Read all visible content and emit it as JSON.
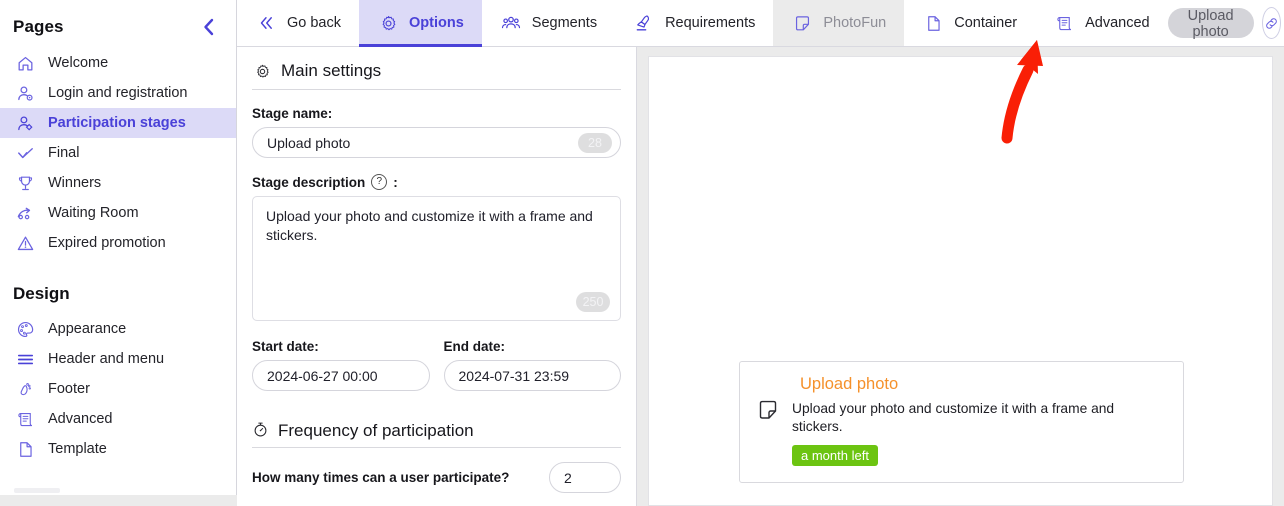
{
  "sidebar": {
    "pages_title": "Pages",
    "collapse_icon": "chevron-left-icon",
    "pages": [
      {
        "label": "Welcome",
        "icon": "home-icon",
        "active": false
      },
      {
        "label": "Login and registration",
        "icon": "user-gear-icon",
        "active": false
      },
      {
        "label": "Participation stages",
        "icon": "user-stages-icon",
        "active": true
      },
      {
        "label": "Final",
        "icon": "check-badge-icon",
        "active": false
      },
      {
        "label": "Winners",
        "icon": "trophy-icon",
        "active": false
      },
      {
        "label": "Waiting Room",
        "icon": "waiting-room-icon",
        "active": false
      },
      {
        "label": "Expired promotion",
        "icon": "warning-triangle-icon",
        "active": false
      }
    ],
    "design_title": "Design",
    "design": [
      {
        "label": "Appearance",
        "icon": "palette-icon"
      },
      {
        "label": "Header and menu",
        "icon": "menu-lines-icon"
      },
      {
        "label": "Footer",
        "icon": "footprint-icon"
      },
      {
        "label": "Advanced",
        "icon": "scroll-icon"
      },
      {
        "label": "Template",
        "icon": "page-icon"
      }
    ]
  },
  "tabs": [
    {
      "label": "Go back",
      "icon": "double-chevron-left-icon",
      "state": "normal"
    },
    {
      "label": "Options",
      "icon": "gear-icon",
      "state": "active"
    },
    {
      "label": "Segments",
      "icon": "people-group-icon",
      "state": "normal"
    },
    {
      "label": "Requirements",
      "icon": "stamp-icon",
      "state": "normal"
    },
    {
      "label": "PhotoFun",
      "icon": "sticker-icon",
      "state": "muted"
    },
    {
      "label": "Container",
      "icon": "page-icon",
      "state": "normal"
    },
    {
      "label": "Advanced",
      "icon": "scroll-icon",
      "state": "normal"
    }
  ],
  "toolbar": {
    "upload_button": "Upload photo",
    "link_icon": "link-chain-icon"
  },
  "settings": {
    "main_section": {
      "icon": "gear-icon",
      "title": "Main settings"
    },
    "stage_name": {
      "label": "Stage name:",
      "value": "Upload photo",
      "counter": "28"
    },
    "stage_description": {
      "label": "Stage description",
      "help_icon": "question-mark-icon",
      "colon": ":",
      "value": "Upload your photo and customize it with a frame and stickers.",
      "counter": "250"
    },
    "start_date": {
      "label": "Start date:",
      "value": "2024-06-27 00:00"
    },
    "end_date": {
      "label": "End date:",
      "value": "2024-07-31 23:59"
    },
    "frequency_section": {
      "icon": "stopwatch-icon",
      "title": "Frequency of participation"
    },
    "participate_times": {
      "label": "How many times can a user participate?",
      "value": "2"
    }
  },
  "preview": {
    "stage_card": {
      "title": "Upload photo",
      "sticker_icon": "sticker-icon",
      "description": "Upload your photo and customize it with a frame and stickers.",
      "badge": "a month left"
    }
  },
  "annotation": {
    "arrow_icon": "red-arrow-up-icon",
    "arrow_color": "#f91f06"
  },
  "colors": {
    "accent": "#4a41d8",
    "accent_bg": "#dcdaf7",
    "orange": "#f5912b",
    "green": "#6cc411",
    "page_bg": "#ebebeb"
  }
}
